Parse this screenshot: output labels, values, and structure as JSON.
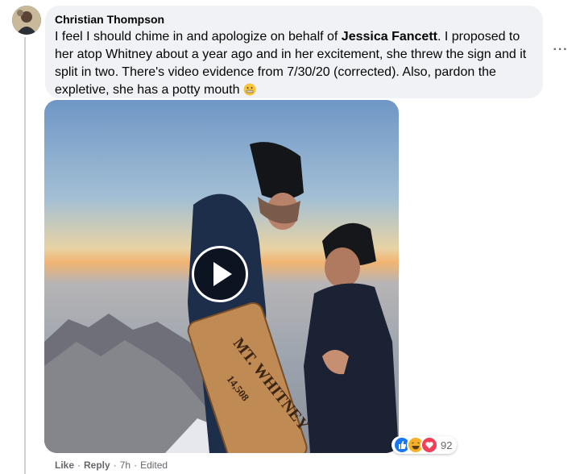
{
  "comment": {
    "author": "Christian Thompson",
    "text_before_mention": "I feel I should chime in and apologize on behalf of ",
    "mention": "Jessica Fancett",
    "text_after_mention": ". I proposed to her atop Whitney about a year ago and in her excitement, she threw the sign and it split in two. There's video evidence from 7/30/20 (corrected). Also, pardon the expletive, she has a potty mouth",
    "emoji": "grimacing-face"
  },
  "video": {
    "sign_name": "MT. WHITNEY",
    "sign_elevation": "14,508"
  },
  "reactions": {
    "types": [
      "like",
      "haha",
      "love"
    ],
    "count": "92"
  },
  "actions": {
    "like": "Like",
    "reply": "Reply",
    "time": "7h",
    "edited": "Edited",
    "separator": "·"
  },
  "colors": {
    "bubble": "#f0f2f5",
    "secondary_text": "#65676b",
    "like_blue": "#1877f2",
    "haha_yellow": "#f7b125",
    "love_red": "#f33e58"
  }
}
